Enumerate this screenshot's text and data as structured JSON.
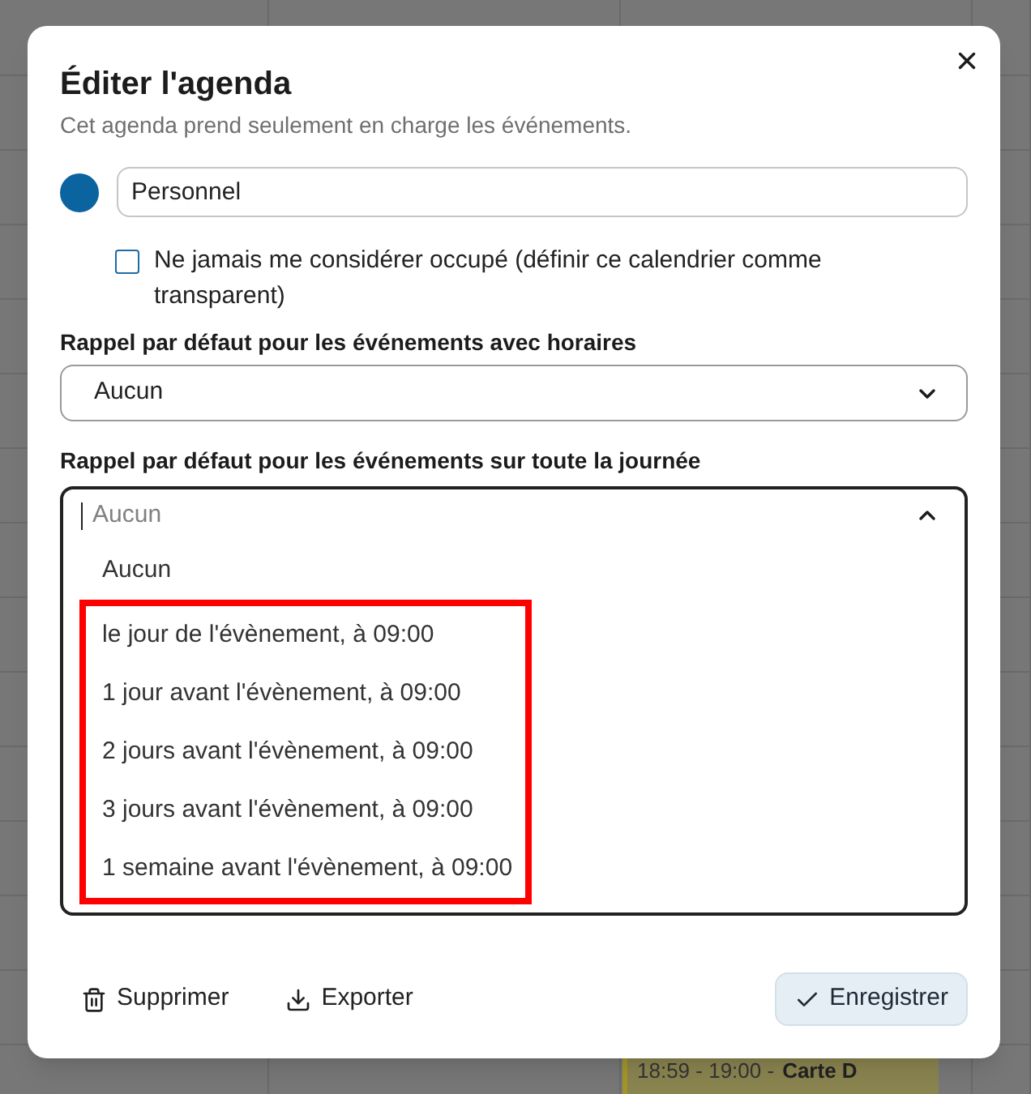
{
  "backdrop": {
    "event": {
      "time": "18:59 - 19:00 -",
      "title": "Carte D"
    }
  },
  "dialog": {
    "title": "Éditer l'agenda",
    "subtitle": "Cet agenda prend seulement en charge les événements.",
    "calendar": {
      "color": "#0b64a0",
      "name": "Personnel"
    },
    "transparent_option": {
      "label": "Ne jamais me considérer occupé (définir ce calendrier comme transparent)",
      "checked": false
    },
    "reminders": [
      {
        "label": "Rappel par défaut pour les événements avec horaires",
        "value": "Aucun",
        "expanded": false
      },
      {
        "label": "Rappel par défaut pour les événements sur toute la journée",
        "placeholder": "Aucun",
        "expanded": true,
        "options": [
          {
            "label": "Aucun",
            "highlighted": false
          },
          {
            "label": "le jour de l'évènement, à 09:00",
            "highlighted": true
          },
          {
            "label": "1 jour avant l'évènement, à 09:00",
            "highlighted": true
          },
          {
            "label": "2 jours avant l'évènement, à 09:00",
            "highlighted": true
          },
          {
            "label": "3 jours avant l'évènement, à 09:00",
            "highlighted": true
          },
          {
            "label": "1 semaine avant l'évènement, à 09:00",
            "highlighted": true
          }
        ]
      }
    ],
    "actions": [
      {
        "kind": "delete",
        "label": "Supprimer"
      },
      {
        "kind": "export",
        "label": "Exporter"
      },
      {
        "kind": "save",
        "label": "Enregistrer"
      }
    ]
  }
}
